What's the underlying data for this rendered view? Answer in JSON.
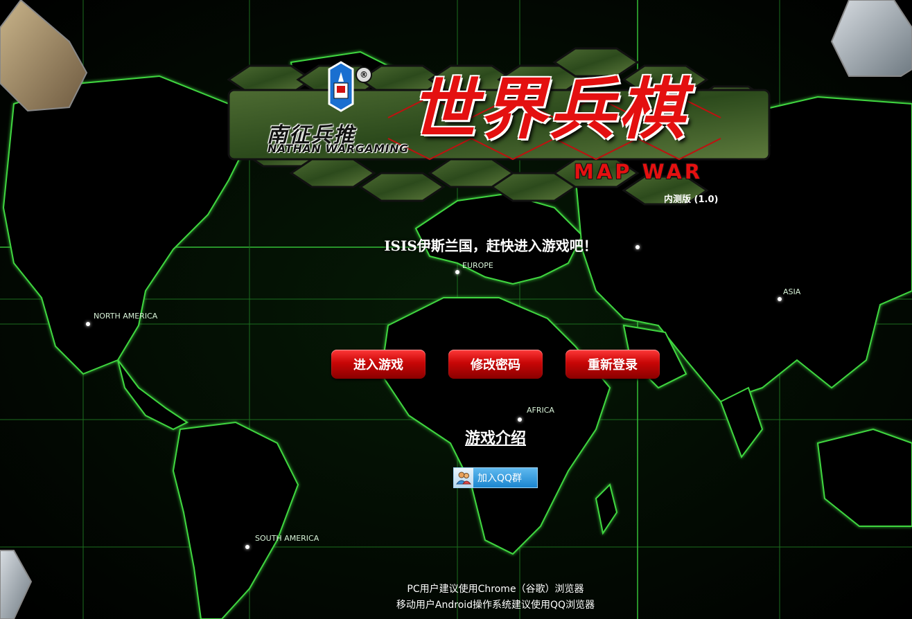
{
  "logo": {
    "registered_mark": "®",
    "brand_cn": "南征兵推",
    "brand_en": "NATHAN WARGAMING",
    "title_cn": "世界兵棋",
    "title_en": "MAP WAR",
    "version": "内测版 (1.0)"
  },
  "map_labels": {
    "north_america": "NORTH AMERICA",
    "europe": "EUROPE",
    "asia": "ASIA",
    "africa": "AFRICA",
    "south_america": "SOUTH AMERICA"
  },
  "headline": "ISIS伊斯兰国，赶快进入游戏吧！",
  "buttons": {
    "enter_game": "进入游戏",
    "change_password": "修改密码",
    "relogin": "重新登录"
  },
  "game_intro_link": "游戏介绍",
  "qq_group": {
    "label": "加入QQ群",
    "icon": "qq-users-icon"
  },
  "footer": {
    "line1": "PC用户建议使用Chrome（谷歌）浏览器",
    "line2": "移动用户Android操作系统建议使用QQ浏览器"
  },
  "colors": {
    "background": "#000000",
    "map_glow": "#39c43a",
    "button_red": "#c80606",
    "title_red": "#e41010",
    "qq_blue": "#2a93d8"
  }
}
